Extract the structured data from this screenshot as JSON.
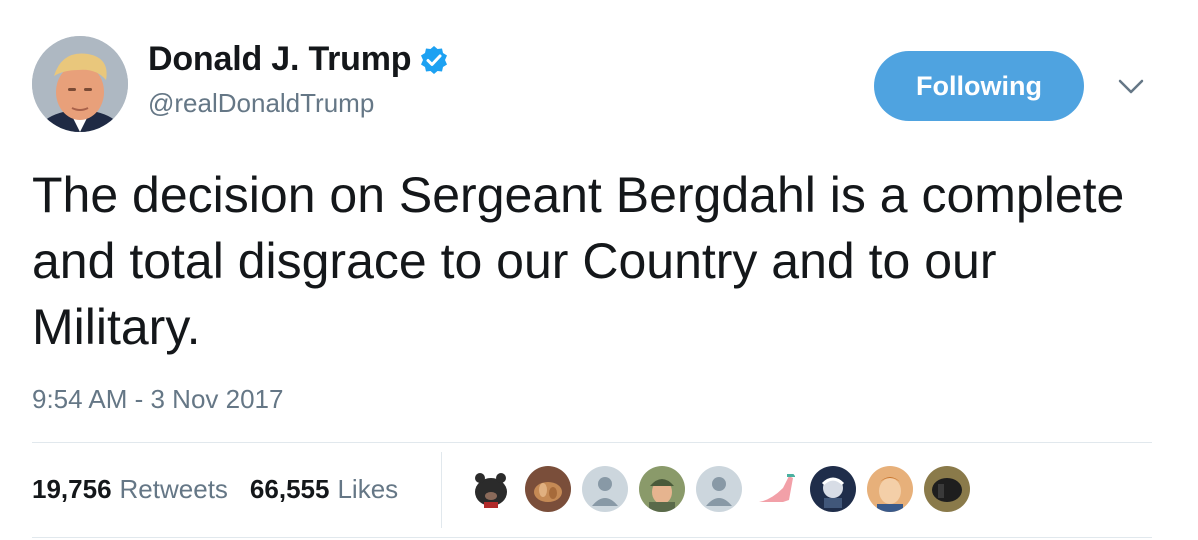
{
  "author": {
    "display_name": "Donald J. Trump",
    "handle": "@realDonaldTrump",
    "verified": true,
    "verified_badge_color": "#1da1f2"
  },
  "follow_button": {
    "label": "Following",
    "color": "#4fa3e0"
  },
  "menu": {
    "icon": "chevron-down-icon"
  },
  "tweet": {
    "text": "The decision on Sergeant Bergdahl is a complete and total disgrace to our Country and to our Military.",
    "timestamp": "9:54 AM - 3 Nov 2017"
  },
  "stats": {
    "retweets": {
      "count": "19,756",
      "label": "Retweets"
    },
    "likes": {
      "count": "66,555",
      "label": "Likes"
    }
  },
  "likers": [
    {
      "icon": "bear-avatar"
    },
    {
      "icon": "food-photo-avatar"
    },
    {
      "icon": "default-avatar"
    },
    {
      "icon": "person-cap-avatar"
    },
    {
      "icon": "default-avatar"
    },
    {
      "icon": "high-heel-avatar"
    },
    {
      "icon": "illustration-avatar"
    },
    {
      "icon": "person-avatar"
    },
    {
      "icon": "dark-object-avatar"
    }
  ]
}
